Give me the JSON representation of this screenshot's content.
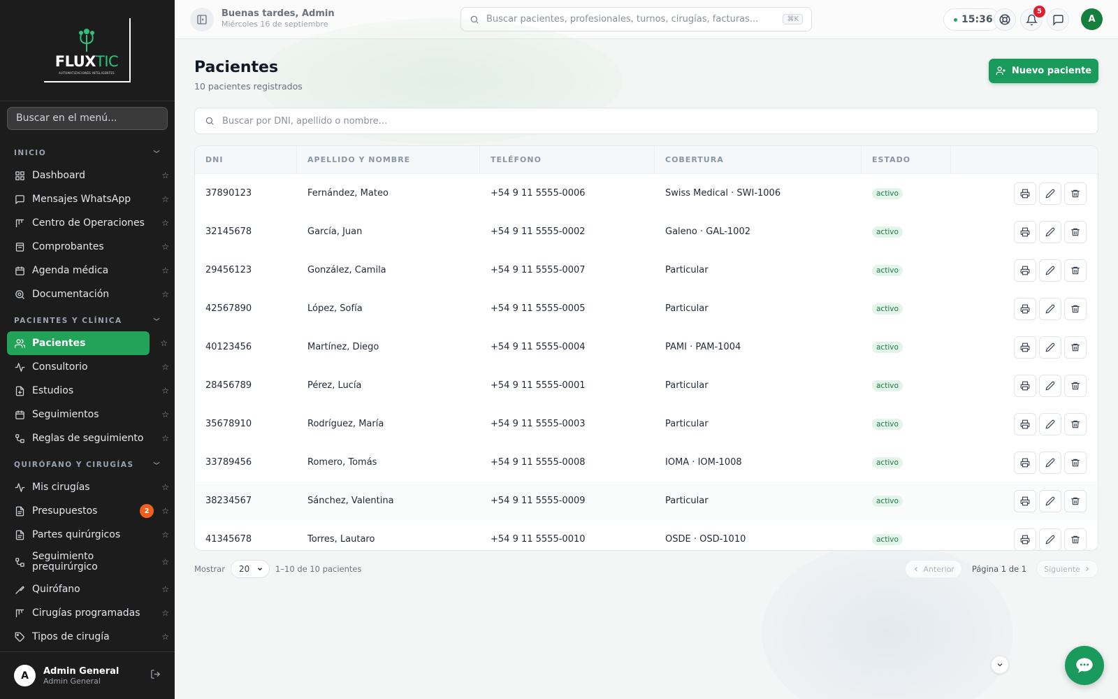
{
  "brand": {
    "logo_main": "FLUX",
    "logo_accent": "TIC",
    "logo_sub": "AUTOMATIZACIONES INTELIGENTES"
  },
  "sidebar": {
    "search_placeholder": "Buscar en el menú...",
    "sections": [
      {
        "title": "INICIO",
        "items": [
          {
            "label": "Dashboard",
            "icon": "grid-icon"
          },
          {
            "label": "Mensajes WhatsApp",
            "icon": "message-icon"
          },
          {
            "label": "Centro de Operaciones",
            "icon": "kanban-icon"
          },
          {
            "label": "Comprobantes",
            "icon": "receipt-icon"
          },
          {
            "label": "Agenda médica",
            "icon": "calendar-icon"
          },
          {
            "label": "Documentación",
            "icon": "search-doc-icon"
          }
        ]
      },
      {
        "title": "PACIENTES Y CLÍNICA",
        "items": [
          {
            "label": "Pacientes",
            "icon": "users-icon",
            "active": true
          },
          {
            "label": "Consultorio",
            "icon": "activity-icon"
          },
          {
            "label": "Estudios",
            "icon": "file-plus-icon"
          },
          {
            "label": "Seguimientos",
            "icon": "calendar-icon"
          },
          {
            "label": "Reglas de seguimiento",
            "icon": "workflow-icon"
          }
        ]
      },
      {
        "title": "QUIRÓFANO Y CIRUGÍAS",
        "items": [
          {
            "label": "Mis cirugías",
            "icon": "activity-icon"
          },
          {
            "label": "Presupuestos",
            "icon": "file-icon",
            "badge": "2"
          },
          {
            "label": "Partes quirúrgicos",
            "icon": "file-icon"
          },
          {
            "label": "Seguimiento prequirúrgico",
            "icon": "workflow-icon"
          },
          {
            "label": "Quirófano",
            "icon": "scalpel-icon"
          },
          {
            "label": "Cirugías programadas",
            "icon": "kanban-icon"
          },
          {
            "label": "Tipos de cirugía",
            "icon": "tag-icon"
          }
        ]
      }
    ],
    "user": {
      "initial": "A",
      "name": "Admin General",
      "role": "Admin General"
    }
  },
  "topbar": {
    "greeting": "Buenas tardes, Admin",
    "date": "Miércoles 16 de septiembre",
    "search_placeholder": "Buscar pacientes, profesionales, turnos, cirugías, facturas...",
    "shortcut": "⌘K",
    "time": "15:36",
    "notifications": "5",
    "avatar": "A"
  },
  "page": {
    "title": "Pacientes",
    "subtitle": "10 pacientes registrados",
    "new_button": "Nuevo paciente",
    "search_placeholder": "Buscar por DNI, apellido o nombre..."
  },
  "table": {
    "columns": [
      "DNI",
      "APELLIDO Y NOMBRE",
      "TELÉFONO",
      "COBERTURA",
      "ESTADO"
    ],
    "rows": [
      {
        "dni": "37890123",
        "name": "Fernández, Mateo",
        "phone": "+54 9 11 5555-0006",
        "coverage": "Swiss Medical · SWI-1006",
        "status": "activo"
      },
      {
        "dni": "32145678",
        "name": "García, Juan",
        "phone": "+54 9 11 5555-0002",
        "coverage": "Galeno · GAL-1002",
        "status": "activo"
      },
      {
        "dni": "29456123",
        "name": "González, Camila",
        "phone": "+54 9 11 5555-0007",
        "coverage": "Particular",
        "status": "activo"
      },
      {
        "dni": "42567890",
        "name": "López, Sofía",
        "phone": "+54 9 11 5555-0005",
        "coverage": "Particular",
        "status": "activo"
      },
      {
        "dni": "40123456",
        "name": "Martínez, Diego",
        "phone": "+54 9 11 5555-0004",
        "coverage": "PAMI · PAM-1004",
        "status": "activo"
      },
      {
        "dni": "28456789",
        "name": "Pérez, Lucía",
        "phone": "+54 9 11 5555-0001",
        "coverage": "Particular",
        "status": "activo"
      },
      {
        "dni": "35678910",
        "name": "Rodríguez, María",
        "phone": "+54 9 11 5555-0003",
        "coverage": "Particular",
        "status": "activo"
      },
      {
        "dni": "33789456",
        "name": "Romero, Tomás",
        "phone": "+54 9 11 5555-0008",
        "coverage": "IOMA · IOM-1008",
        "status": "activo"
      },
      {
        "dni": "38234567",
        "name": "Sánchez, Valentina",
        "phone": "+54 9 11 5555-0009",
        "coverage": "Particular",
        "status": "activo"
      },
      {
        "dni": "41345678",
        "name": "Torres, Lautaro",
        "phone": "+54 9 11 5555-0010",
        "coverage": "OSDE · OSD-1010",
        "status": "activo"
      }
    ]
  },
  "pager": {
    "show_label": "Mostrar",
    "page_size": "20",
    "range": "1–10 de 10 pacientes",
    "prev": "Anterior",
    "page_info": "Página 1 de 1",
    "next": "Siguiente"
  },
  "colors": {
    "brand_green": "#1a9a5c",
    "sidebar_bg": "#1c1c1c",
    "active_item": "#22a35a",
    "badge_orange": "#f25f1c",
    "notif_red": "#e11d2e"
  }
}
